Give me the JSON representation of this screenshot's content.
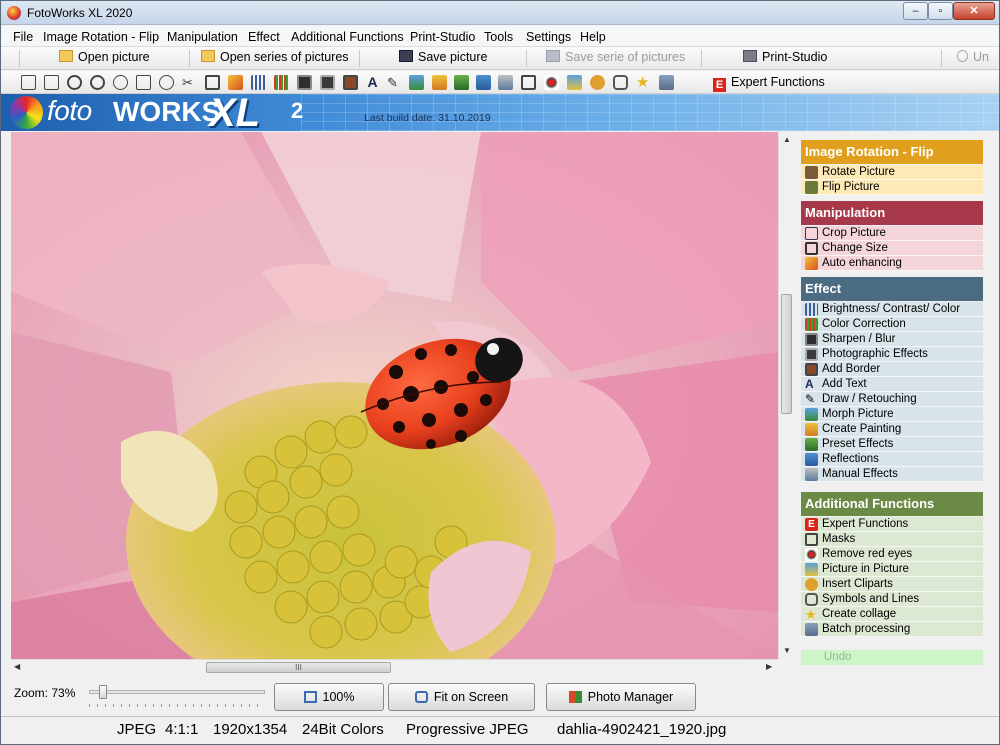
{
  "window": {
    "title": "FotoWorks XL 2020"
  },
  "menu": [
    "File",
    "Image Rotation - Flip",
    "Manipulation",
    "Effect",
    "Additional Functions",
    "Print-Studio",
    "Tools",
    "Settings",
    "Help"
  ],
  "toolbar": {
    "open_picture": "Open picture",
    "open_series": "Open series of pictures",
    "save_picture": "Save picture",
    "save_series": "Save serie of pictures",
    "print_studio": "Print-Studio",
    "undo_partial": "Un",
    "expert_functions": "Expert Functions",
    "expert_badge": "E"
  },
  "banner": {
    "logo_foto": "foto",
    "logo_works": "WORKS",
    "logo_xl": "XL",
    "logo_version": "2",
    "build_date": "Last build date: 31.10.2019"
  },
  "panel": {
    "sections": [
      {
        "title": "Image Rotation - Flip",
        "color": "#e0a01e",
        "item_bg": "#fde9b6",
        "items": [
          "Rotate Picture",
          "Flip Picture"
        ]
      },
      {
        "title": "Manipulation",
        "color": "#a8394a",
        "item_bg": "#f4d6da",
        "items": [
          "Crop Picture",
          "Change Size",
          "Auto enhancing"
        ]
      },
      {
        "title": "Effect",
        "color": "#4b6b80",
        "item_bg": "#d9e3ea",
        "items": [
          "Brightness/ Contrast/ Color",
          "Color Correction",
          "Sharpen / Blur",
          "Photographic Effects",
          "Add Border",
          "Add Text",
          "Draw / Retouching",
          "Morph Picture",
          "Create Painting",
          "Preset Effects",
          "Reflections",
          "Manual Effects"
        ]
      },
      {
        "title": "Additional Functions",
        "color": "#6b8a46",
        "item_bg": "#dde8d3",
        "items": [
          "Expert Functions",
          "Masks",
          "Remove red eyes",
          "Picture in Picture",
          "Insert Cliparts",
          "Symbols and Lines",
          "Create collage",
          "Batch processing"
        ]
      }
    ],
    "undo": "Undo"
  },
  "zoom": {
    "label": "Zoom: 73%",
    "level": 0.73
  },
  "buttons": {
    "hundred": "100%",
    "fit": "Fit on Screen",
    "photo_manager": "Photo Manager"
  },
  "hscroll_grip": "III",
  "status": [
    "JPEG",
    "4:1:1",
    "1920x1354",
    "24Bit Colors",
    "Progressive JPEG",
    "dahlia-4902421_1920.jpg"
  ]
}
